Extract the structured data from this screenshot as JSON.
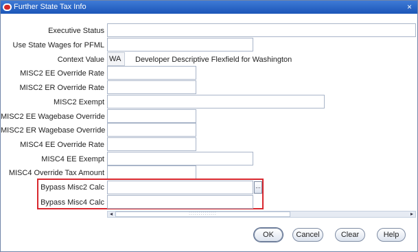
{
  "window": {
    "title": "Further State Tax Info",
    "close_glyph": "×"
  },
  "fields": {
    "executive_status": {
      "label": "Executive Status",
      "value": ""
    },
    "use_state_wages_pfml": {
      "label": "Use State Wages for PFML",
      "value": ""
    },
    "context_value": {
      "label": "Context Value",
      "value": "WA",
      "description": "Developer Descriptive Flexfield for Washington"
    },
    "misc2_ee_override_rate": {
      "label": "MISC2 EE Override Rate",
      "value": ""
    },
    "misc2_er_override_rate": {
      "label": "MISC2 ER Override Rate",
      "value": ""
    },
    "misc2_exempt": {
      "label": "MISC2 Exempt",
      "value": ""
    },
    "misc2_ee_wagebase_override": {
      "label": "MISC2 EE Wagebase Override",
      "value": ""
    },
    "misc2_er_wagebase_override": {
      "label": "MISC2 ER Wagebase Override",
      "value": ""
    },
    "misc4_ee_override_rate": {
      "label": "MISC4 EE Override Rate",
      "value": ""
    },
    "misc4_ee_exempt": {
      "label": "MISC4 EE Exempt",
      "value": ""
    },
    "misc4_override_tax_amount": {
      "label": "MISC4 Override Tax Amount",
      "value": ""
    },
    "bypass_misc2_calc": {
      "label": "Bypass Misc2 Calc",
      "value": ""
    },
    "bypass_misc4_calc": {
      "label": "Bypass Misc4 Calc",
      "value": ""
    }
  },
  "lov_button": {
    "glyph": "..."
  },
  "scrollbar": {
    "left_glyph": "◂",
    "right_glyph": "▸",
    "thumb_grip": "⁚⁚⁚⁚⁚⁚⁚⁚⁚⁚⁚⁚⁚⁚"
  },
  "buttons": {
    "ok": "OK",
    "cancel": "Cancel",
    "clear": "Clear",
    "help": "Help"
  },
  "colors": {
    "titlebar": "#1c56b8",
    "highlight_border": "#d8262d"
  }
}
